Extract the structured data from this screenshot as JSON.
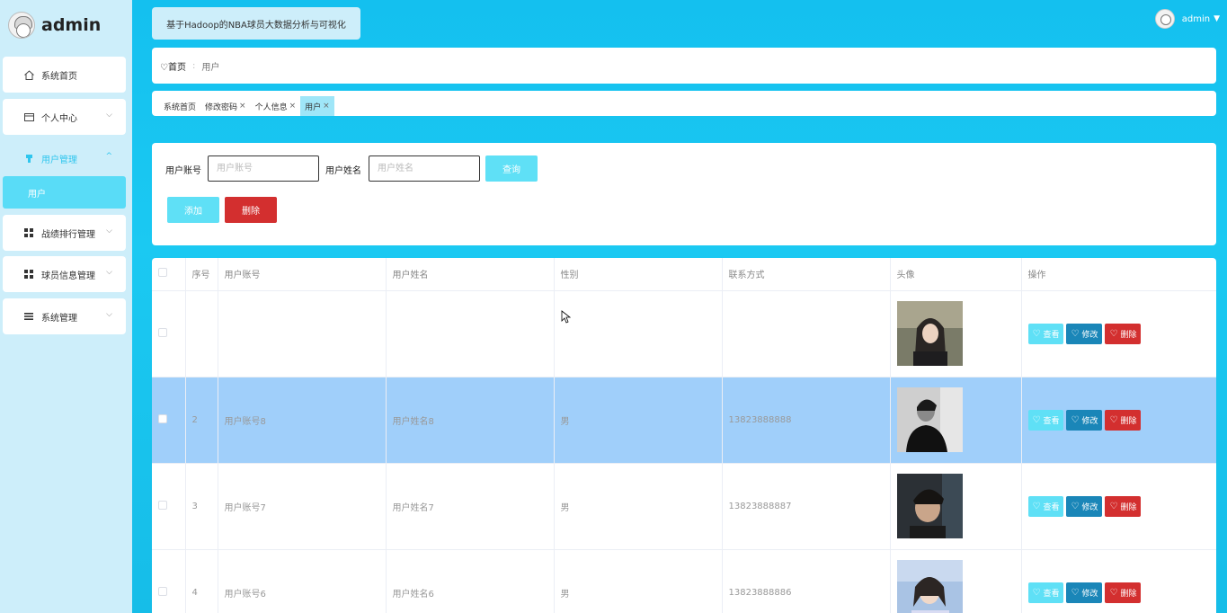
{
  "brand": {
    "name": "admin"
  },
  "sidebar": {
    "items": [
      {
        "label": "系统首页",
        "icon": "home-icon"
      },
      {
        "label": "个人中心",
        "icon": "id-card-icon"
      },
      {
        "label": "用户管理",
        "icon": "user-icon"
      },
      {
        "label": "战绩排行管理",
        "icon": "grid-icon"
      },
      {
        "label": "球员信息管理",
        "icon": "grid-icon"
      },
      {
        "label": "系统管理",
        "icon": "list-icon"
      }
    ],
    "submenu": {
      "label": "用户"
    }
  },
  "header": {
    "title": "基于Hadoop的NBA球员大数据分析与可视化",
    "user": "admin"
  },
  "breadcrumb": {
    "home": "首页",
    "current": "用户"
  },
  "tags": [
    {
      "label": "系统首页"
    },
    {
      "label": "修改密码"
    },
    {
      "label": "个人信息"
    },
    {
      "label": "用户"
    }
  ],
  "search": {
    "account_label": "用户账号",
    "account_placeholder": "用户账号",
    "name_label": "用户姓名",
    "name_placeholder": "用户姓名",
    "query_label": "查询",
    "add_label": "添加",
    "delete_label": "删除"
  },
  "table": {
    "headers": [
      "序号",
      "用户账号",
      "用户姓名",
      "性别",
      "联系方式",
      "头像",
      "操作"
    ],
    "ops": {
      "view": "查看",
      "edit": "修改",
      "delete": "删除"
    },
    "rows": [
      {
        "index": "",
        "account": "",
        "name": "",
        "gender": "",
        "phone": ""
      },
      {
        "index": "2",
        "account": "用户账号8",
        "name": "用户姓名8",
        "gender": "男",
        "phone": "13823888888"
      },
      {
        "index": "3",
        "account": "用户账号7",
        "name": "用户姓名7",
        "gender": "男",
        "phone": "13823888887"
      },
      {
        "index": "4",
        "account": "用户账号6",
        "name": "用户姓名6",
        "gender": "男",
        "phone": "13823888886"
      }
    ]
  },
  "colors": {
    "accent": "#5fe0f6",
    "danger": "#d32f2f",
    "edit": "#1a86b8",
    "selected_row": "#a0cffa"
  }
}
